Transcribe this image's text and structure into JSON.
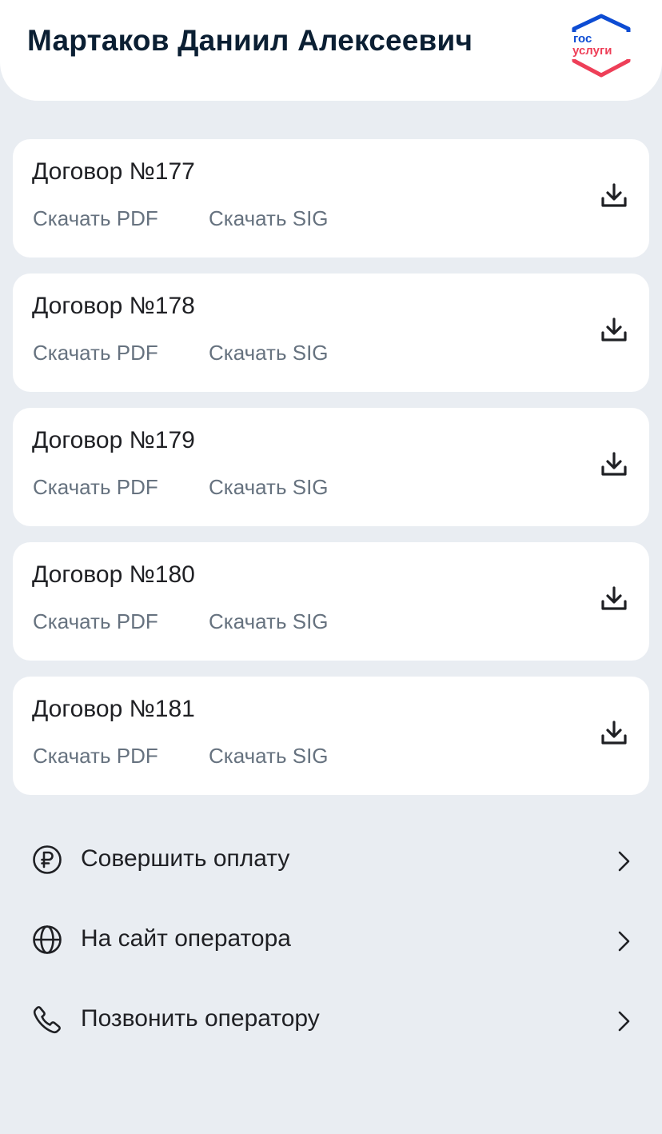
{
  "header": {
    "user_name": "Мартаков Даниил Алексеевич",
    "logo": {
      "text_top": "гос",
      "text_bottom": "услуги",
      "colors": {
        "blue": "#0d4cd3",
        "red": "#ee3f58"
      }
    }
  },
  "contracts": [
    {
      "title": "Договор №177",
      "pdf_label": "Скачать PDF",
      "sig_label": "Скачать SIG"
    },
    {
      "title": "Договор №178",
      "pdf_label": "Скачать PDF",
      "sig_label": "Скачать SIG"
    },
    {
      "title": "Договор №179",
      "pdf_label": "Скачать PDF",
      "sig_label": "Скачать SIG"
    },
    {
      "title": "Договор №180",
      "pdf_label": "Скачать PDF",
      "sig_label": "Скачать SIG"
    },
    {
      "title": "Договор №181",
      "pdf_label": "Скачать PDF",
      "sig_label": "Скачать SIG"
    }
  ],
  "actions": [
    {
      "label": "Совершить оплату",
      "icon": "ruble-icon"
    },
    {
      "label": "На сайт оператора",
      "icon": "globe-icon"
    },
    {
      "label": "Позвонить оператору",
      "icon": "phone-icon"
    }
  ],
  "colors": {
    "background": "#e9edf2",
    "card": "#ffffff",
    "title_text": "#0b1f33",
    "secondary_text": "#66727f"
  }
}
